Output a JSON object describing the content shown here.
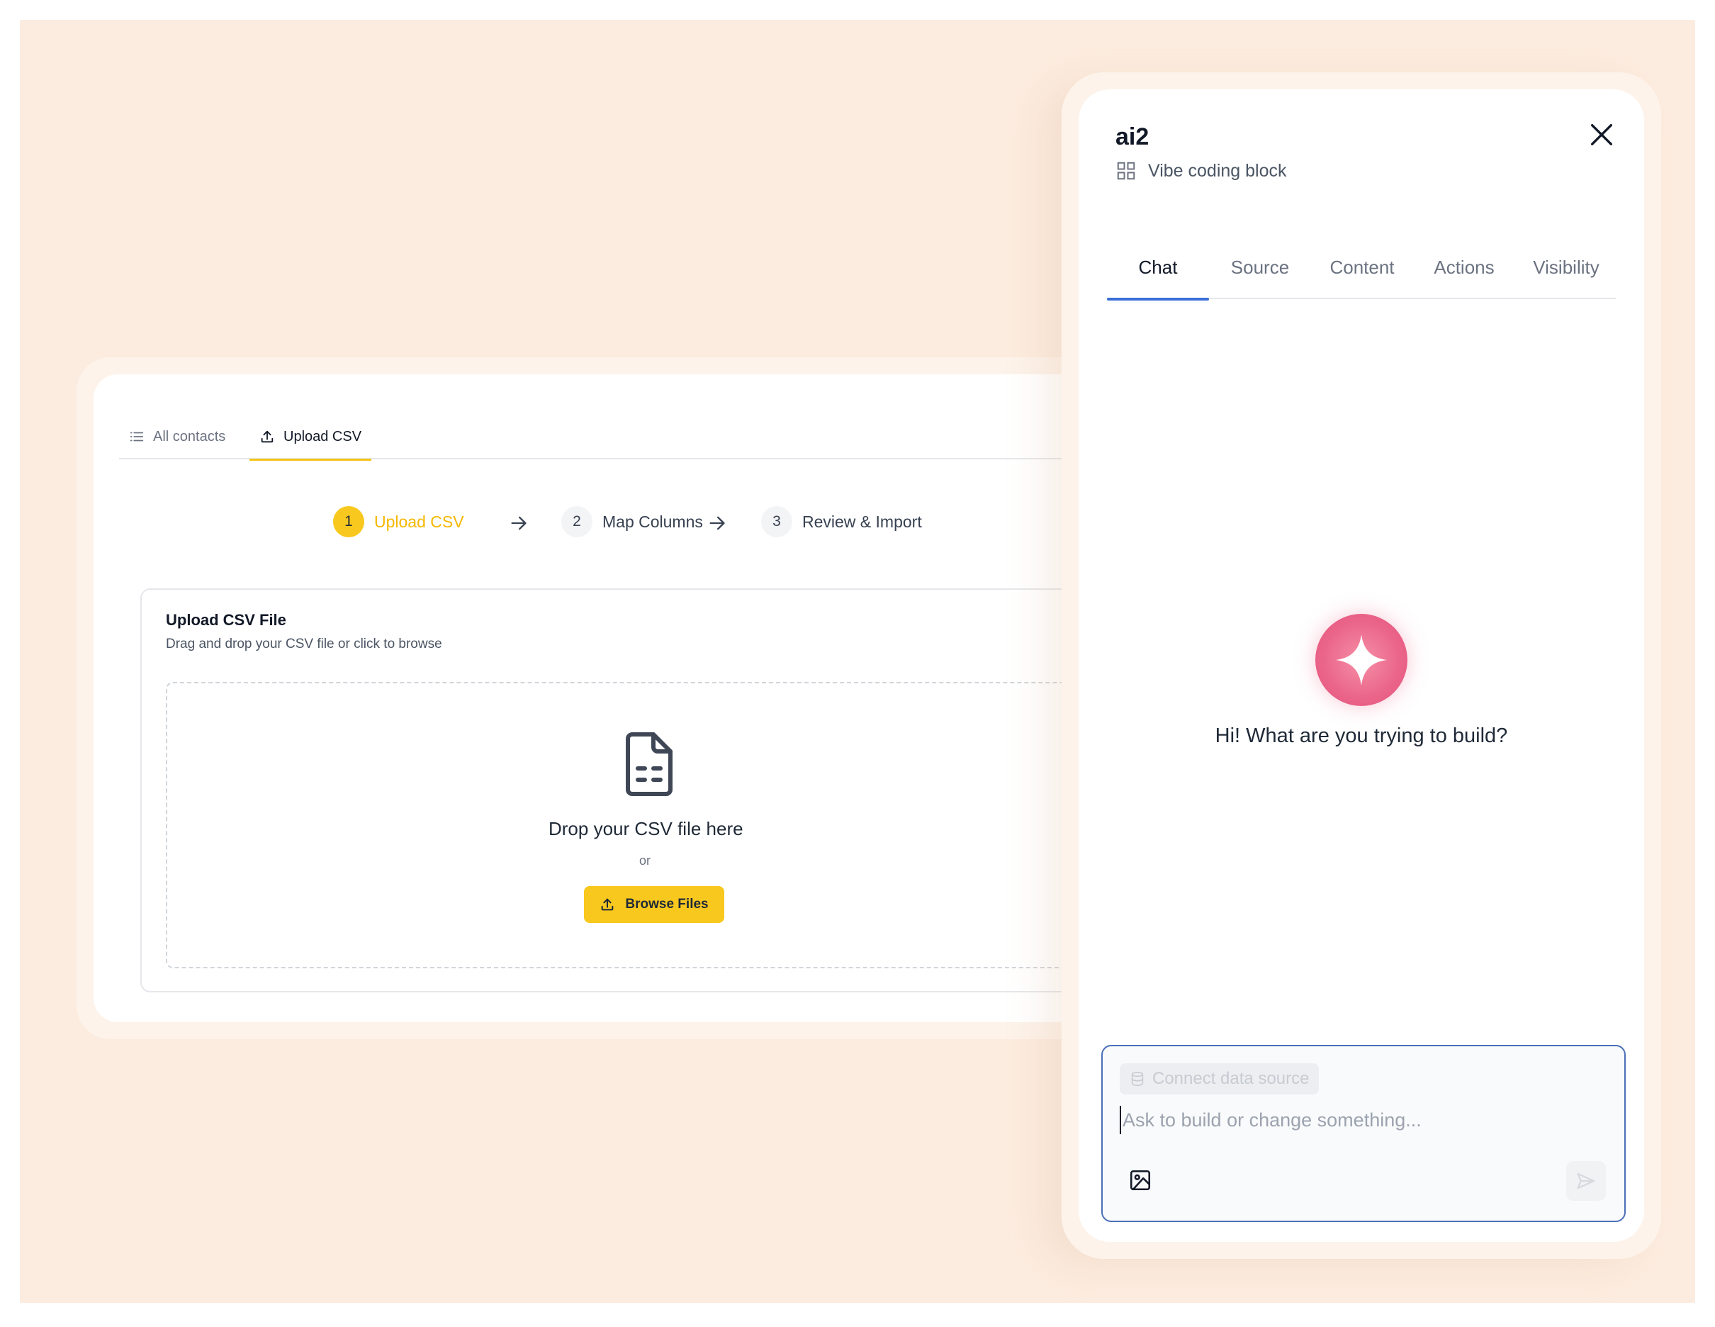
{
  "left_panel": {
    "tabs": [
      {
        "label": "All contacts",
        "icon": "list-icon"
      },
      {
        "label": "Upload CSV",
        "icon": "upload-icon"
      }
    ],
    "steps": [
      {
        "number": "1",
        "label": "Upload CSV"
      },
      {
        "number": "2",
        "label": "Map Columns"
      },
      {
        "number": "3",
        "label": "Review & Import"
      }
    ],
    "upload": {
      "title": "Upload CSV File",
      "subtitle": "Drag and drop your CSV file or click to browse",
      "drop_text": "Drop your CSV file here",
      "or_text": "or",
      "browse_label": "Browse Files"
    }
  },
  "ai_panel": {
    "title": "ai2",
    "subtitle": "Vibe coding block",
    "tabs": [
      "Chat",
      "Source",
      "Content",
      "Actions",
      "Visibility"
    ],
    "greeting": "Hi! What are you trying to build?",
    "composer": {
      "chip_label": "Connect data source",
      "placeholder": "Ask to build or change something..."
    }
  },
  "colors": {
    "background": "#fcecdf",
    "accent_yellow": "#f9c81e",
    "active_tab_blue": "#3b6fd8",
    "sparkle_pink": "#ea6489"
  }
}
